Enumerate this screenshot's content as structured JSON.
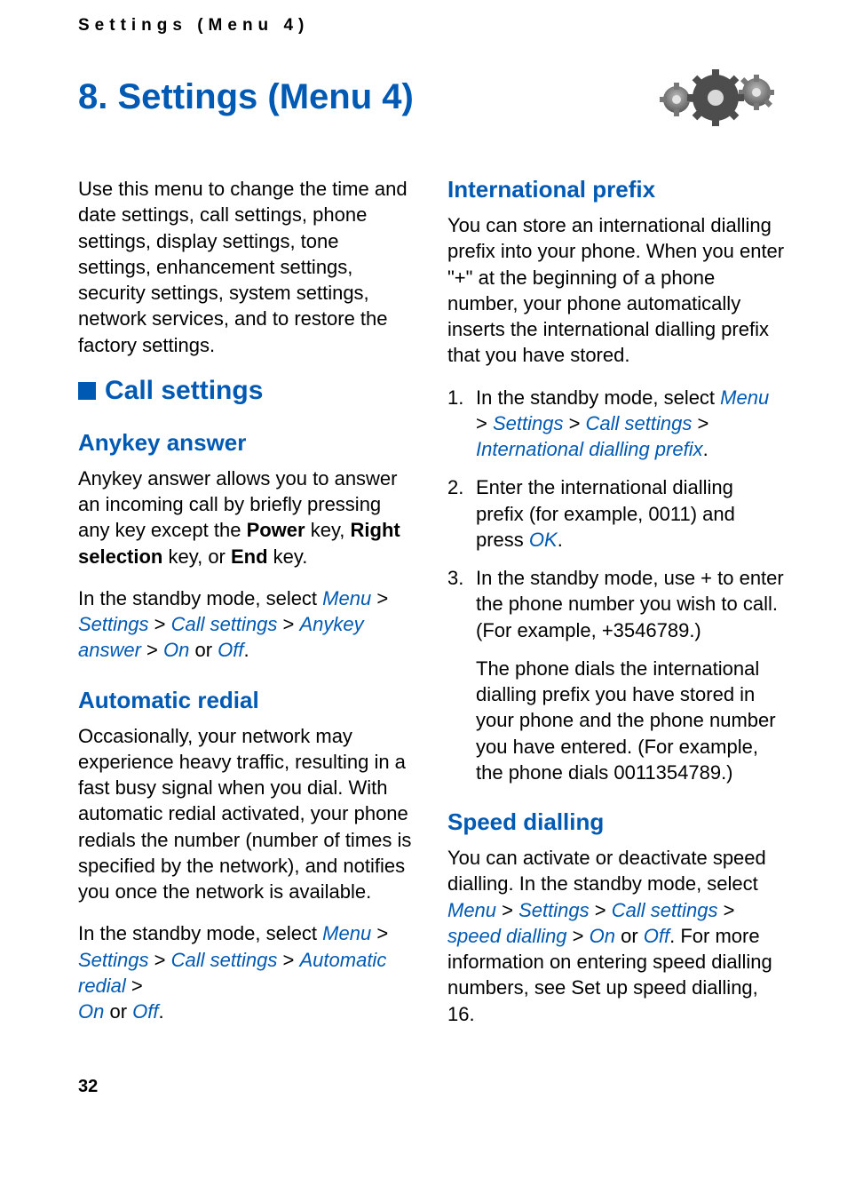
{
  "running_header": "Settings (Menu 4)",
  "chapter_title": "8.   Settings (Menu 4)",
  "intro": "Use this menu to change the time and date settings, call settings, phone settings, display settings, tone settings, enhancement settings, security settings, system settings, network services, and to restore the factory settings.",
  "call_settings_heading": "Call settings",
  "anykey": {
    "heading": "Anykey answer",
    "body_pre": "Anykey answer allows you to answer an incoming call by briefly pressing any key except the ",
    "power": "Power",
    "body_mid1": " key, ",
    "right_selection": "Right selection",
    "body_mid2": " key, or ",
    "end": "End",
    "body_post": " key.",
    "instr_pre": "In the standby mode, select ",
    "p_menu": "Menu",
    "p_settings": "Settings",
    "p_call": "Call settings",
    "p_anykey": "Anykey answer",
    "p_on": "On",
    "p_off": "Off",
    "instr_or": " or "
  },
  "redial": {
    "heading": "Automatic redial",
    "body": "Occasionally, your network may experience heavy traffic, resulting in a fast busy signal when you dial. With automatic redial activated, your phone redials the number (number of times is specified by the network), and notifies you once the network is available.",
    "instr_pre": "In the standby mode, select ",
    "p_menu": "Menu",
    "p_settings": "Settings",
    "p_call": "Call settings",
    "p_auto": "Automatic redial",
    "p_on": "On",
    "p_off": "Off",
    "instr_or": " or "
  },
  "intl": {
    "heading": "International prefix",
    "body": "You can store an international dialling prefix into your phone. When you enter \"+\" at the beginning of a phone number, your phone automatically inserts the international dialling prefix that you have stored.",
    "li1_pre": "In the standby mode, select ",
    "p_menu": "Menu",
    "p_settings": "Settings",
    "p_call": "Call settings",
    "p_intl": "International dialling prefix",
    "li2_pre": "Enter the international dialling prefix (for example, 0011) and press ",
    "p_ok": "OK",
    "li3_a": "In the standby mode, use + to enter the phone number you wish to call. (For example, +3546789.)",
    "li3_b": "The phone dials the international dialling prefix you have stored in your phone and the phone number you have entered. (For example, the phone dials 0011354789.)"
  },
  "speed": {
    "heading": "Speed dialling",
    "body_pre": "You can activate or deactivate speed dialling. In the standby mode, select ",
    "p_menu": "Menu",
    "p_settings": "Settings",
    "p_call": "Call settings",
    "p_speed": "speed dialling",
    "p_on": "On",
    "p_off": "Off",
    "body_mid": ". For more information on entering speed dialling numbers, see Set up speed dialling, 16.",
    "instr_or": " or "
  },
  "page_number": "32"
}
